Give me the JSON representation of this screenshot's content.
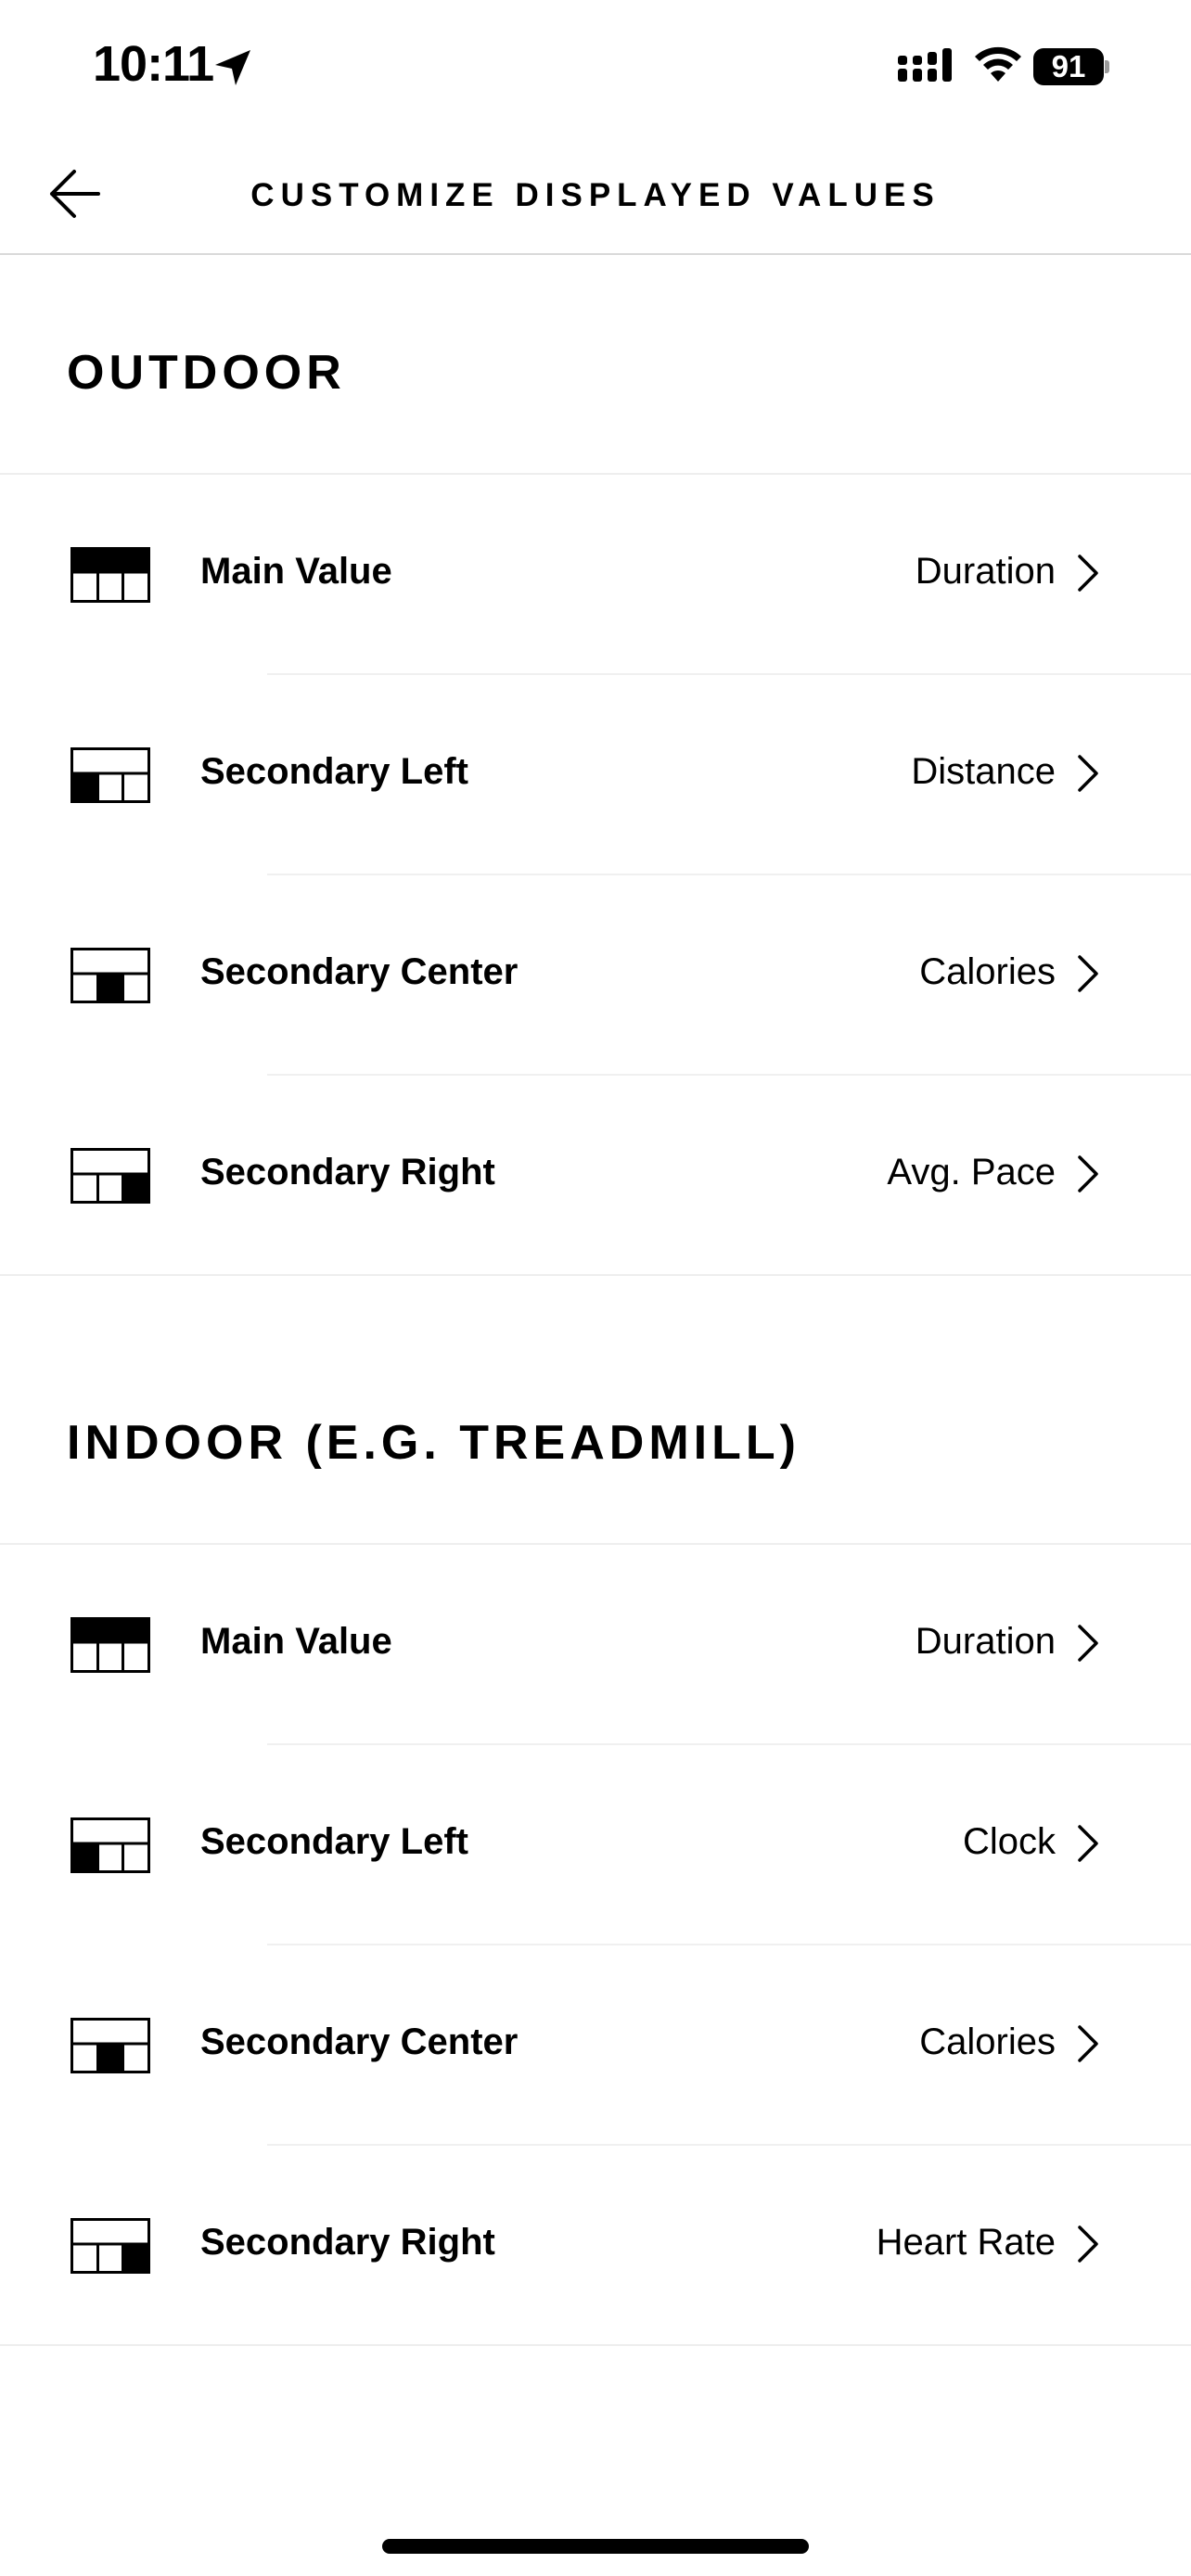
{
  "status_bar": {
    "time": "10:11",
    "battery_level": "91",
    "icons": [
      "location-arrow-icon",
      "cellular-signal-icon",
      "wifi-icon",
      "battery-icon"
    ]
  },
  "header": {
    "title": "CUSTOMIZE DISPLAYED VALUES",
    "back_icon": "arrow-left-icon"
  },
  "sections": [
    {
      "title": "OUTDOOR",
      "rows": [
        {
          "label": "Main Value",
          "value": "Duration",
          "icon": "layout-main-icon"
        },
        {
          "label": "Secondary Left",
          "value": "Distance",
          "icon": "layout-left-icon"
        },
        {
          "label": "Secondary Center",
          "value": "Calories",
          "icon": "layout-center-icon"
        },
        {
          "label": "Secondary Right",
          "value": "Avg. Pace",
          "icon": "layout-right-icon"
        }
      ]
    },
    {
      "title": "INDOOR (E.G. TREADMILL)",
      "rows": [
        {
          "label": "Main Value",
          "value": "Duration",
          "icon": "layout-main-icon"
        },
        {
          "label": "Secondary Left",
          "value": "Clock",
          "icon": "layout-left-icon"
        },
        {
          "label": "Secondary Center",
          "value": "Calories",
          "icon": "layout-center-icon"
        },
        {
          "label": "Secondary Right",
          "value": "Heart Rate",
          "icon": "layout-right-icon"
        }
      ]
    }
  ],
  "colors": {
    "background": "#ffffff",
    "text": "#000000",
    "divider": "#eeeeee"
  }
}
